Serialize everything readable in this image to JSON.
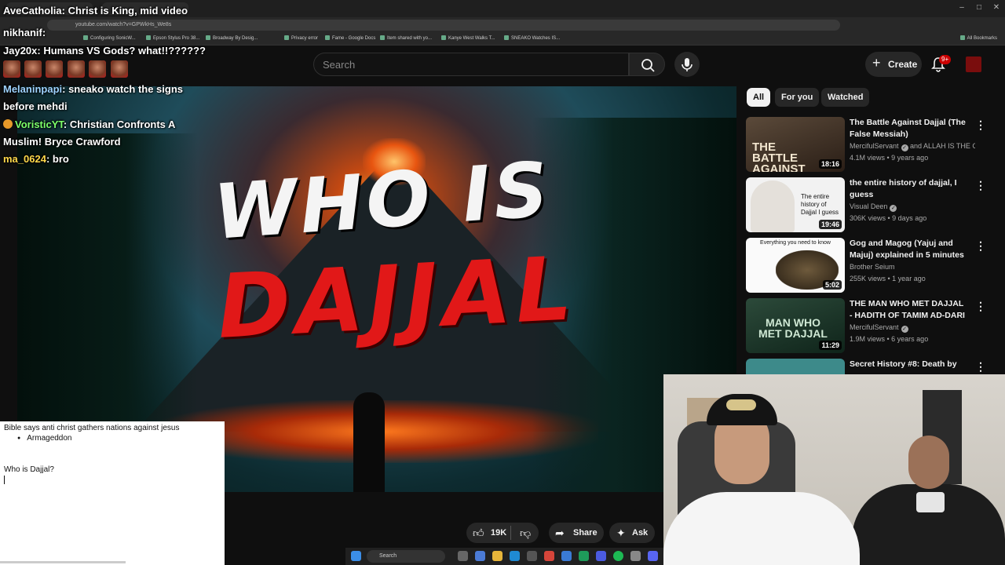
{
  "browser": {
    "url": "youtube.com/watch?v=GPWkHs_We8s",
    "bookmarks": [
      "Configuring SonicW...",
      "Epson Stylus Pro 38...",
      "Broadway By Desig...",
      "Privacy error",
      "Fame - Google Docs",
      "Item shared with yo...",
      "Kanye West Walks T...",
      "SNEAKO Watches IS..."
    ],
    "all_bookmarks": "All Bookmarks"
  },
  "header": {
    "search_placeholder": "Search",
    "create_label": "Create",
    "notification_count": "9+"
  },
  "video": {
    "thumbnail_title_top": "WHO IS",
    "thumbnail_title_bottom": "DAJJAL",
    "like_count": "19K",
    "share_label": "Share",
    "ask_label": "Ask"
  },
  "filters": [
    "All",
    "For you",
    "Watched"
  ],
  "recommendations": [
    {
      "title": "The Battle Against Dajjal (The False Messiah)",
      "channel": "MercifulServant",
      "channel_extra": " and ALLAH IS THE G...",
      "meta": "4.1M views • 9 years ago",
      "duration": "18:16",
      "thumb_text": "THE BATTLE AGAINST DAJJAL"
    },
    {
      "title": "the entire history of dajjal, I guess",
      "channel": "Visual Deen",
      "channel_extra": "",
      "meta": "306K views • 9 days ago",
      "duration": "19:46",
      "thumb_text": "The entire history of Dajjal I guess"
    },
    {
      "title": "Gog and Magog (Yajuj and Majuj) explained in 5 minutes",
      "channel": "Brother Seium",
      "channel_extra": "",
      "meta": "255K views • 1 year ago",
      "duration": "5:02",
      "thumb_text": "Everything you need to know"
    },
    {
      "title": "THE MAN WHO MET DAJJAL - HADITH OF TAMIM AD-DARI",
      "channel": "MercifulServant",
      "channel_extra": "",
      "meta": "1.9M views • 6 years ago",
      "duration": "11:29",
      "thumb_text": "MAN WHO MET DAJJAL"
    },
    {
      "title": "Secret History #8: Death by",
      "channel": "",
      "channel_extra": "",
      "meta": "",
      "duration": "",
      "thumb_text": ""
    }
  ],
  "chat": [
    {
      "user": "AveCatholia",
      "message": "Christ is King, mid video",
      "color": "#ffffff"
    },
    {
      "user": "nikhanif",
      "message": "",
      "color": "#ffffff"
    },
    {
      "user": "Jay20x",
      "message": "Humans VS Gods? what!!??????",
      "color": "#ffffff"
    },
    {
      "user": "Melaninpapi",
      "message": "sneako watch the signs",
      "color": "#9fd3ff"
    },
    {
      "user": "",
      "message": "before mehdi",
      "color": "#ffffff"
    },
    {
      "user": "VoristicYT",
      "message": "Christian Confronts A",
      "color": "#7cff6a"
    },
    {
      "user": "",
      "message": "Muslim! Bryce Crawford",
      "color": "#ffffff"
    },
    {
      "user": "ma_0624",
      "message": "bro",
      "color": "#ffd84a"
    }
  ],
  "notes": {
    "line1": "Bible says anti christ gathers nations against jesus",
    "bullet": "Armageddon",
    "question": "Who is Dajjal?"
  },
  "taskbar": {
    "search_label": "Search"
  },
  "colors": {
    "background": "#0f0f0f",
    "accent_red": "#e11818",
    "badge_red": "#cc0000"
  }
}
